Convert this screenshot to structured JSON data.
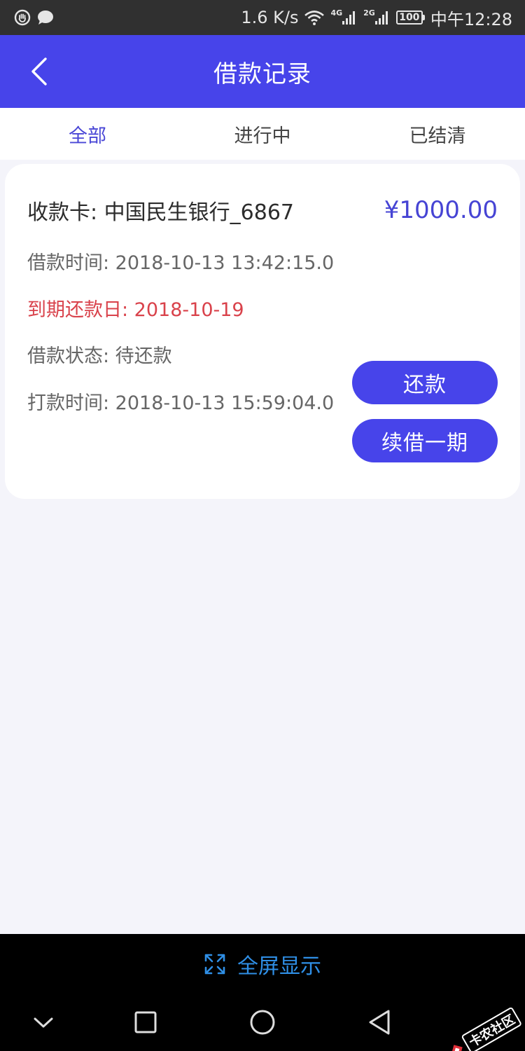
{
  "status_bar": {
    "speed": "1.6 K/s",
    "net1": "4G",
    "net2": "2G",
    "battery": "100",
    "time": "中午12:28"
  },
  "header": {
    "title": "借款记录"
  },
  "tabs": [
    {
      "label": "全部",
      "active": true
    },
    {
      "label": "进行中",
      "active": false
    },
    {
      "label": "已结清",
      "active": false
    }
  ],
  "card": {
    "bank": "收款卡: 中国民生银行_6867",
    "amount": "¥1000.00",
    "borrow_time": "借款时间: 2018-10-13 13:42:15.0",
    "due_date": "到期还款日: 2018-10-19",
    "status": "借款状态: 待还款",
    "payout_time": "打款时间: 2018-10-13 15:59:04.0",
    "repay_button": "还款",
    "renew_button": "续借一期"
  },
  "fullscreen": {
    "label": "全屏显示"
  },
  "watermark": {
    "text": "卡农社区"
  },
  "colors": {
    "brand": "#4744ea",
    "due_red": "#d9424b",
    "fullscreen_blue": "#2f8fe6"
  },
  "icons": [
    "hand-icon",
    "chat-icon",
    "wifi-icon",
    "signal-icon",
    "battery-icon",
    "back-chevron-icon",
    "expand-icon",
    "nav-down-icon",
    "nav-square-icon",
    "nav-circle-icon",
    "nav-triangle-icon"
  ]
}
